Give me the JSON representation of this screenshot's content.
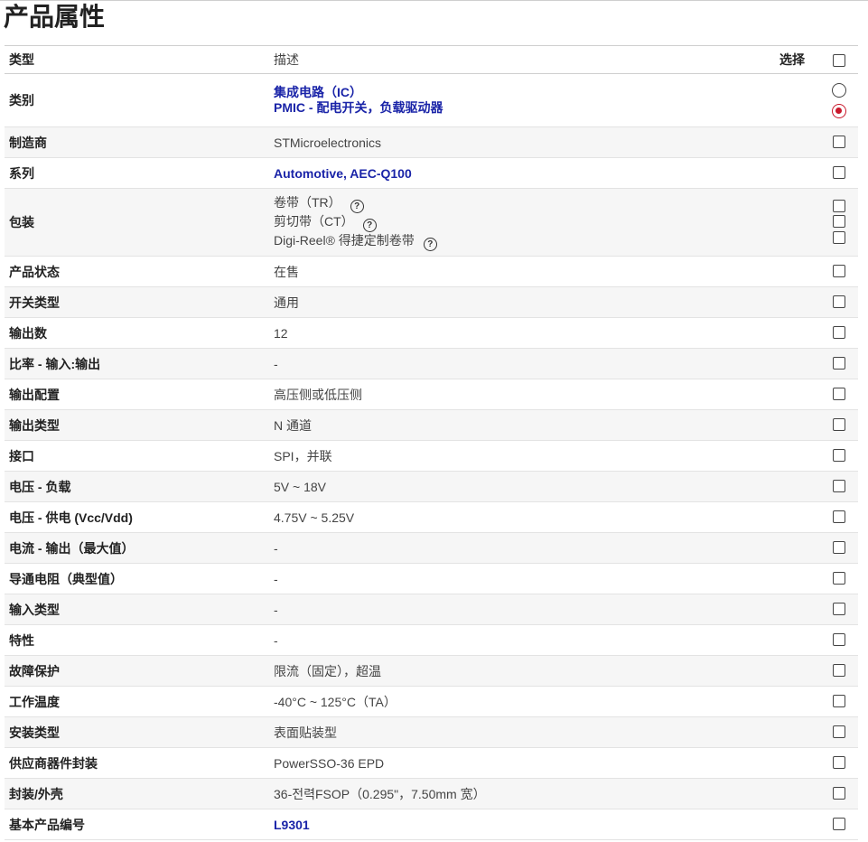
{
  "page": {
    "title": "产品属性"
  },
  "header": {
    "type": "类型",
    "desc": "描述",
    "select": "选择"
  },
  "rows": {
    "category": {
      "label": "类别",
      "values": [
        "集成电路（IC）",
        "PMIC - 配电开关，负载驱动器"
      ]
    },
    "manufacturer": {
      "label": "制造商",
      "value": "STMicroelectronics"
    },
    "series": {
      "label": "系列",
      "value": "Automotive, AEC-Q100"
    },
    "packaging": {
      "label": "包装",
      "values": [
        "卷带（TR）",
        "剪切带（CT）",
        "Digi-Reel® 得捷定制卷带"
      ]
    },
    "status": {
      "label": "产品状态",
      "value": "在售"
    },
    "switch_type": {
      "label": "开关类型",
      "value": "通用"
    },
    "outputs": {
      "label": "输出数",
      "value": "12"
    },
    "ratio": {
      "label": "比率 - 输入:输出",
      "value": "-"
    },
    "output_config": {
      "label": "输出配置",
      "value": "高压侧或低压侧"
    },
    "output_type": {
      "label": "输出类型",
      "value": "N 通道"
    },
    "interface": {
      "label": "接口",
      "value": "SPI，并联"
    },
    "voltage_load": {
      "label": "电压 - 负载",
      "value": "5V ~ 18V"
    },
    "voltage_supply": {
      "label": "电压 - 供电 (Vcc/Vdd)",
      "value": "4.75V ~ 5.25V"
    },
    "current_output": {
      "label": "电流 - 输出（最大值）",
      "value": "-"
    },
    "rds_on": {
      "label": "导通电阻（典型值）",
      "value": "-"
    },
    "input_type": {
      "label": "输入类型",
      "value": "-"
    },
    "features": {
      "label": "特性",
      "value": "-"
    },
    "fault_protection": {
      "label": "故障保护",
      "value": "限流（固定），超温"
    },
    "operating_temp": {
      "label": "工作温度",
      "value": "-40°C ~ 125°C（TA）"
    },
    "mounting_type": {
      "label": "安装类型",
      "value": "表面贴装型"
    },
    "supplier_package": {
      "label": "供应商器件封装",
      "value": "PowerSSO-36 EPD"
    },
    "package_case": {
      "label": "封装/外壳",
      "value": "36-전력FSOP（0.295\"，7.50mm 宽）"
    },
    "base_part": {
      "label": "基本产品编号",
      "value": "L9301"
    }
  },
  "selection": {
    "category_selected_index": 1
  },
  "colors": {
    "link": "#1a24a8",
    "radio_selected": "#c9182b",
    "row_shade": "#f6f6f6"
  }
}
